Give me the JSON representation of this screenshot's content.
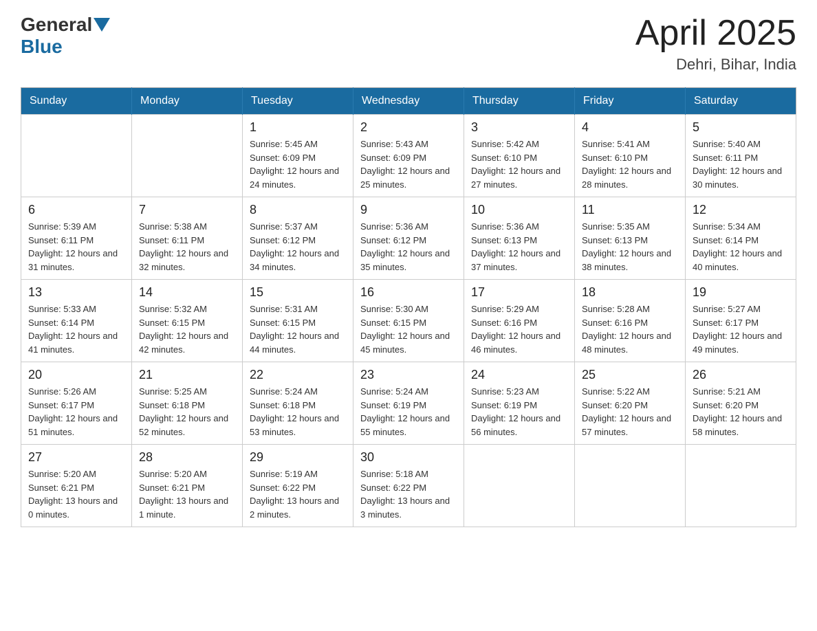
{
  "header": {
    "logo_general": "General",
    "logo_blue": "Blue",
    "month_title": "April 2025",
    "location": "Dehri, Bihar, India"
  },
  "weekdays": [
    "Sunday",
    "Monday",
    "Tuesday",
    "Wednesday",
    "Thursday",
    "Friday",
    "Saturday"
  ],
  "weeks": [
    [
      {
        "day": "",
        "sunrise": "",
        "sunset": "",
        "daylight": ""
      },
      {
        "day": "",
        "sunrise": "",
        "sunset": "",
        "daylight": ""
      },
      {
        "day": "1",
        "sunrise": "Sunrise: 5:45 AM",
        "sunset": "Sunset: 6:09 PM",
        "daylight": "Daylight: 12 hours and 24 minutes."
      },
      {
        "day": "2",
        "sunrise": "Sunrise: 5:43 AM",
        "sunset": "Sunset: 6:09 PM",
        "daylight": "Daylight: 12 hours and 25 minutes."
      },
      {
        "day": "3",
        "sunrise": "Sunrise: 5:42 AM",
        "sunset": "Sunset: 6:10 PM",
        "daylight": "Daylight: 12 hours and 27 minutes."
      },
      {
        "day": "4",
        "sunrise": "Sunrise: 5:41 AM",
        "sunset": "Sunset: 6:10 PM",
        "daylight": "Daylight: 12 hours and 28 minutes."
      },
      {
        "day": "5",
        "sunrise": "Sunrise: 5:40 AM",
        "sunset": "Sunset: 6:11 PM",
        "daylight": "Daylight: 12 hours and 30 minutes."
      }
    ],
    [
      {
        "day": "6",
        "sunrise": "Sunrise: 5:39 AM",
        "sunset": "Sunset: 6:11 PM",
        "daylight": "Daylight: 12 hours and 31 minutes."
      },
      {
        "day": "7",
        "sunrise": "Sunrise: 5:38 AM",
        "sunset": "Sunset: 6:11 PM",
        "daylight": "Daylight: 12 hours and 32 minutes."
      },
      {
        "day": "8",
        "sunrise": "Sunrise: 5:37 AM",
        "sunset": "Sunset: 6:12 PM",
        "daylight": "Daylight: 12 hours and 34 minutes."
      },
      {
        "day": "9",
        "sunrise": "Sunrise: 5:36 AM",
        "sunset": "Sunset: 6:12 PM",
        "daylight": "Daylight: 12 hours and 35 minutes."
      },
      {
        "day": "10",
        "sunrise": "Sunrise: 5:36 AM",
        "sunset": "Sunset: 6:13 PM",
        "daylight": "Daylight: 12 hours and 37 minutes."
      },
      {
        "day": "11",
        "sunrise": "Sunrise: 5:35 AM",
        "sunset": "Sunset: 6:13 PM",
        "daylight": "Daylight: 12 hours and 38 minutes."
      },
      {
        "day": "12",
        "sunrise": "Sunrise: 5:34 AM",
        "sunset": "Sunset: 6:14 PM",
        "daylight": "Daylight: 12 hours and 40 minutes."
      }
    ],
    [
      {
        "day": "13",
        "sunrise": "Sunrise: 5:33 AM",
        "sunset": "Sunset: 6:14 PM",
        "daylight": "Daylight: 12 hours and 41 minutes."
      },
      {
        "day": "14",
        "sunrise": "Sunrise: 5:32 AM",
        "sunset": "Sunset: 6:15 PM",
        "daylight": "Daylight: 12 hours and 42 minutes."
      },
      {
        "day": "15",
        "sunrise": "Sunrise: 5:31 AM",
        "sunset": "Sunset: 6:15 PM",
        "daylight": "Daylight: 12 hours and 44 minutes."
      },
      {
        "day": "16",
        "sunrise": "Sunrise: 5:30 AM",
        "sunset": "Sunset: 6:15 PM",
        "daylight": "Daylight: 12 hours and 45 minutes."
      },
      {
        "day": "17",
        "sunrise": "Sunrise: 5:29 AM",
        "sunset": "Sunset: 6:16 PM",
        "daylight": "Daylight: 12 hours and 46 minutes."
      },
      {
        "day": "18",
        "sunrise": "Sunrise: 5:28 AM",
        "sunset": "Sunset: 6:16 PM",
        "daylight": "Daylight: 12 hours and 48 minutes."
      },
      {
        "day": "19",
        "sunrise": "Sunrise: 5:27 AM",
        "sunset": "Sunset: 6:17 PM",
        "daylight": "Daylight: 12 hours and 49 minutes."
      }
    ],
    [
      {
        "day": "20",
        "sunrise": "Sunrise: 5:26 AM",
        "sunset": "Sunset: 6:17 PM",
        "daylight": "Daylight: 12 hours and 51 minutes."
      },
      {
        "day": "21",
        "sunrise": "Sunrise: 5:25 AM",
        "sunset": "Sunset: 6:18 PM",
        "daylight": "Daylight: 12 hours and 52 minutes."
      },
      {
        "day": "22",
        "sunrise": "Sunrise: 5:24 AM",
        "sunset": "Sunset: 6:18 PM",
        "daylight": "Daylight: 12 hours and 53 minutes."
      },
      {
        "day": "23",
        "sunrise": "Sunrise: 5:24 AM",
        "sunset": "Sunset: 6:19 PM",
        "daylight": "Daylight: 12 hours and 55 minutes."
      },
      {
        "day": "24",
        "sunrise": "Sunrise: 5:23 AM",
        "sunset": "Sunset: 6:19 PM",
        "daylight": "Daylight: 12 hours and 56 minutes."
      },
      {
        "day": "25",
        "sunrise": "Sunrise: 5:22 AM",
        "sunset": "Sunset: 6:20 PM",
        "daylight": "Daylight: 12 hours and 57 minutes."
      },
      {
        "day": "26",
        "sunrise": "Sunrise: 5:21 AM",
        "sunset": "Sunset: 6:20 PM",
        "daylight": "Daylight: 12 hours and 58 minutes."
      }
    ],
    [
      {
        "day": "27",
        "sunrise": "Sunrise: 5:20 AM",
        "sunset": "Sunset: 6:21 PM",
        "daylight": "Daylight: 13 hours and 0 minutes."
      },
      {
        "day": "28",
        "sunrise": "Sunrise: 5:20 AM",
        "sunset": "Sunset: 6:21 PM",
        "daylight": "Daylight: 13 hours and 1 minute."
      },
      {
        "day": "29",
        "sunrise": "Sunrise: 5:19 AM",
        "sunset": "Sunset: 6:22 PM",
        "daylight": "Daylight: 13 hours and 2 minutes."
      },
      {
        "day": "30",
        "sunrise": "Sunrise: 5:18 AM",
        "sunset": "Sunset: 6:22 PM",
        "daylight": "Daylight: 13 hours and 3 minutes."
      },
      {
        "day": "",
        "sunrise": "",
        "sunset": "",
        "daylight": ""
      },
      {
        "day": "",
        "sunrise": "",
        "sunset": "",
        "daylight": ""
      },
      {
        "day": "",
        "sunrise": "",
        "sunset": "",
        "daylight": ""
      }
    ]
  ]
}
